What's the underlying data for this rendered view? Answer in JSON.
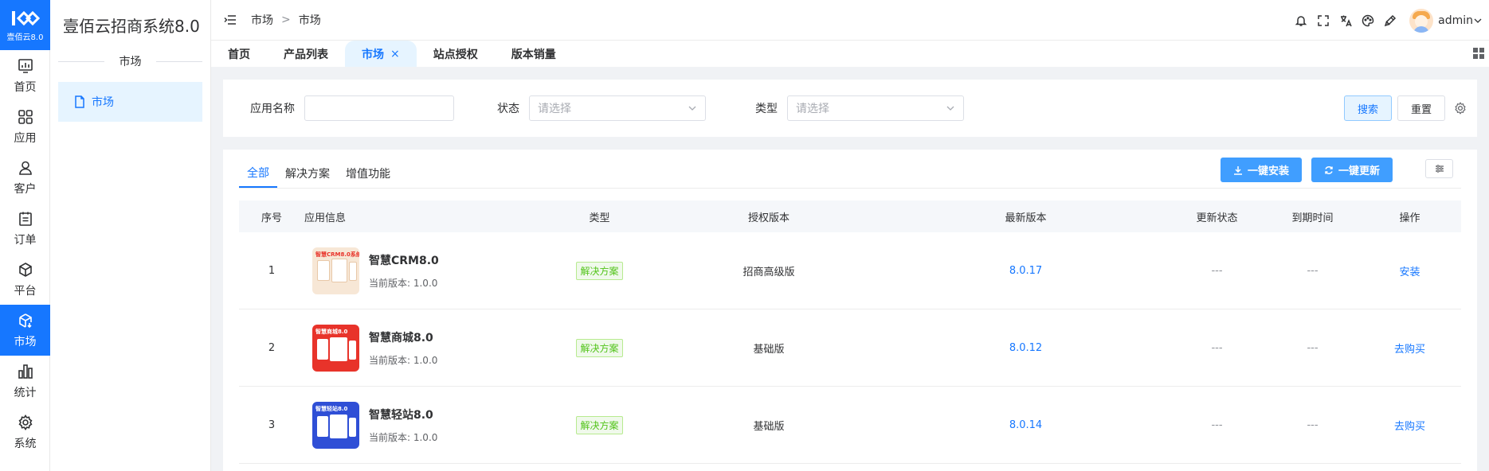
{
  "rail": {
    "logo_text": "壹佰云8.0",
    "items": [
      {
        "label": "首页",
        "icon": "chart-icon"
      },
      {
        "label": "应用",
        "icon": "apps-icon"
      },
      {
        "label": "客户",
        "icon": "user-icon"
      },
      {
        "label": "订单",
        "icon": "order-icon"
      },
      {
        "label": "平台",
        "icon": "cube-icon"
      },
      {
        "label": "市场",
        "icon": "market-icon",
        "active": true
      },
      {
        "label": "统计",
        "icon": "bar-chart-icon"
      },
      {
        "label": "系统",
        "icon": "gear-icon"
      }
    ]
  },
  "subside": {
    "brand": "壹佰云招商系统8.0",
    "group": "市场",
    "menu_item": "市场"
  },
  "header": {
    "breadcrumb": [
      "市场",
      "市场"
    ],
    "breadcrumb_sep": ">",
    "user": "admin"
  },
  "tabs": [
    {
      "label": "首页"
    },
    {
      "label": "产品列表"
    },
    {
      "label": "市场",
      "active": true,
      "close": "×"
    },
    {
      "label": "站点授权"
    },
    {
      "label": "版本销量"
    }
  ],
  "filter": {
    "name_label": "应用名称",
    "name_value": "",
    "status_label": "状态",
    "status_placeholder": "请选择",
    "type_label": "类型",
    "type_placeholder": "请选择",
    "search": "搜索",
    "reset": "重置"
  },
  "card": {
    "subtabs": [
      "全部",
      "解决方案",
      "增值功能"
    ],
    "install_all": "一键安装",
    "update_all": "一键更新"
  },
  "table": {
    "columns": [
      "序号",
      "应用信息",
      "类型",
      "授权版本",
      "最新版本",
      "更新状态",
      "到期时间",
      "操作"
    ],
    "rows": [
      {
        "idx": "1",
        "name": "智慧CRM8.0",
        "version": "当前版本: 1.0.0",
        "thumb_title": "智慧CRM8.0系统",
        "type": "解决方案",
        "auth": "招商高级版",
        "latest": "8.0.17",
        "status": "---",
        "expire": "---",
        "op": "安装"
      },
      {
        "idx": "2",
        "name": "智慧商城8.0",
        "version": "当前版本: 1.0.0",
        "thumb_title": "智慧商城8.0",
        "type": "解决方案",
        "auth": "基础版",
        "latest": "8.0.12",
        "status": "---",
        "expire": "---",
        "op": "去购买"
      },
      {
        "idx": "3",
        "name": "智慧轻站8.0",
        "version": "当前版本: 1.0.0",
        "thumb_title": "智慧轻站8.0",
        "type": "解决方案",
        "auth": "基础版",
        "latest": "8.0.14",
        "status": "---",
        "expire": "---",
        "op": "去购买"
      }
    ]
  },
  "colors": {
    "accent": "#1677ff",
    "button": "#409eff",
    "tag_green": "#52c41a",
    "thumb_crm": "#f7e7d6",
    "thumb_mall": "#e8332a",
    "thumb_site": "#2f4fd6"
  }
}
